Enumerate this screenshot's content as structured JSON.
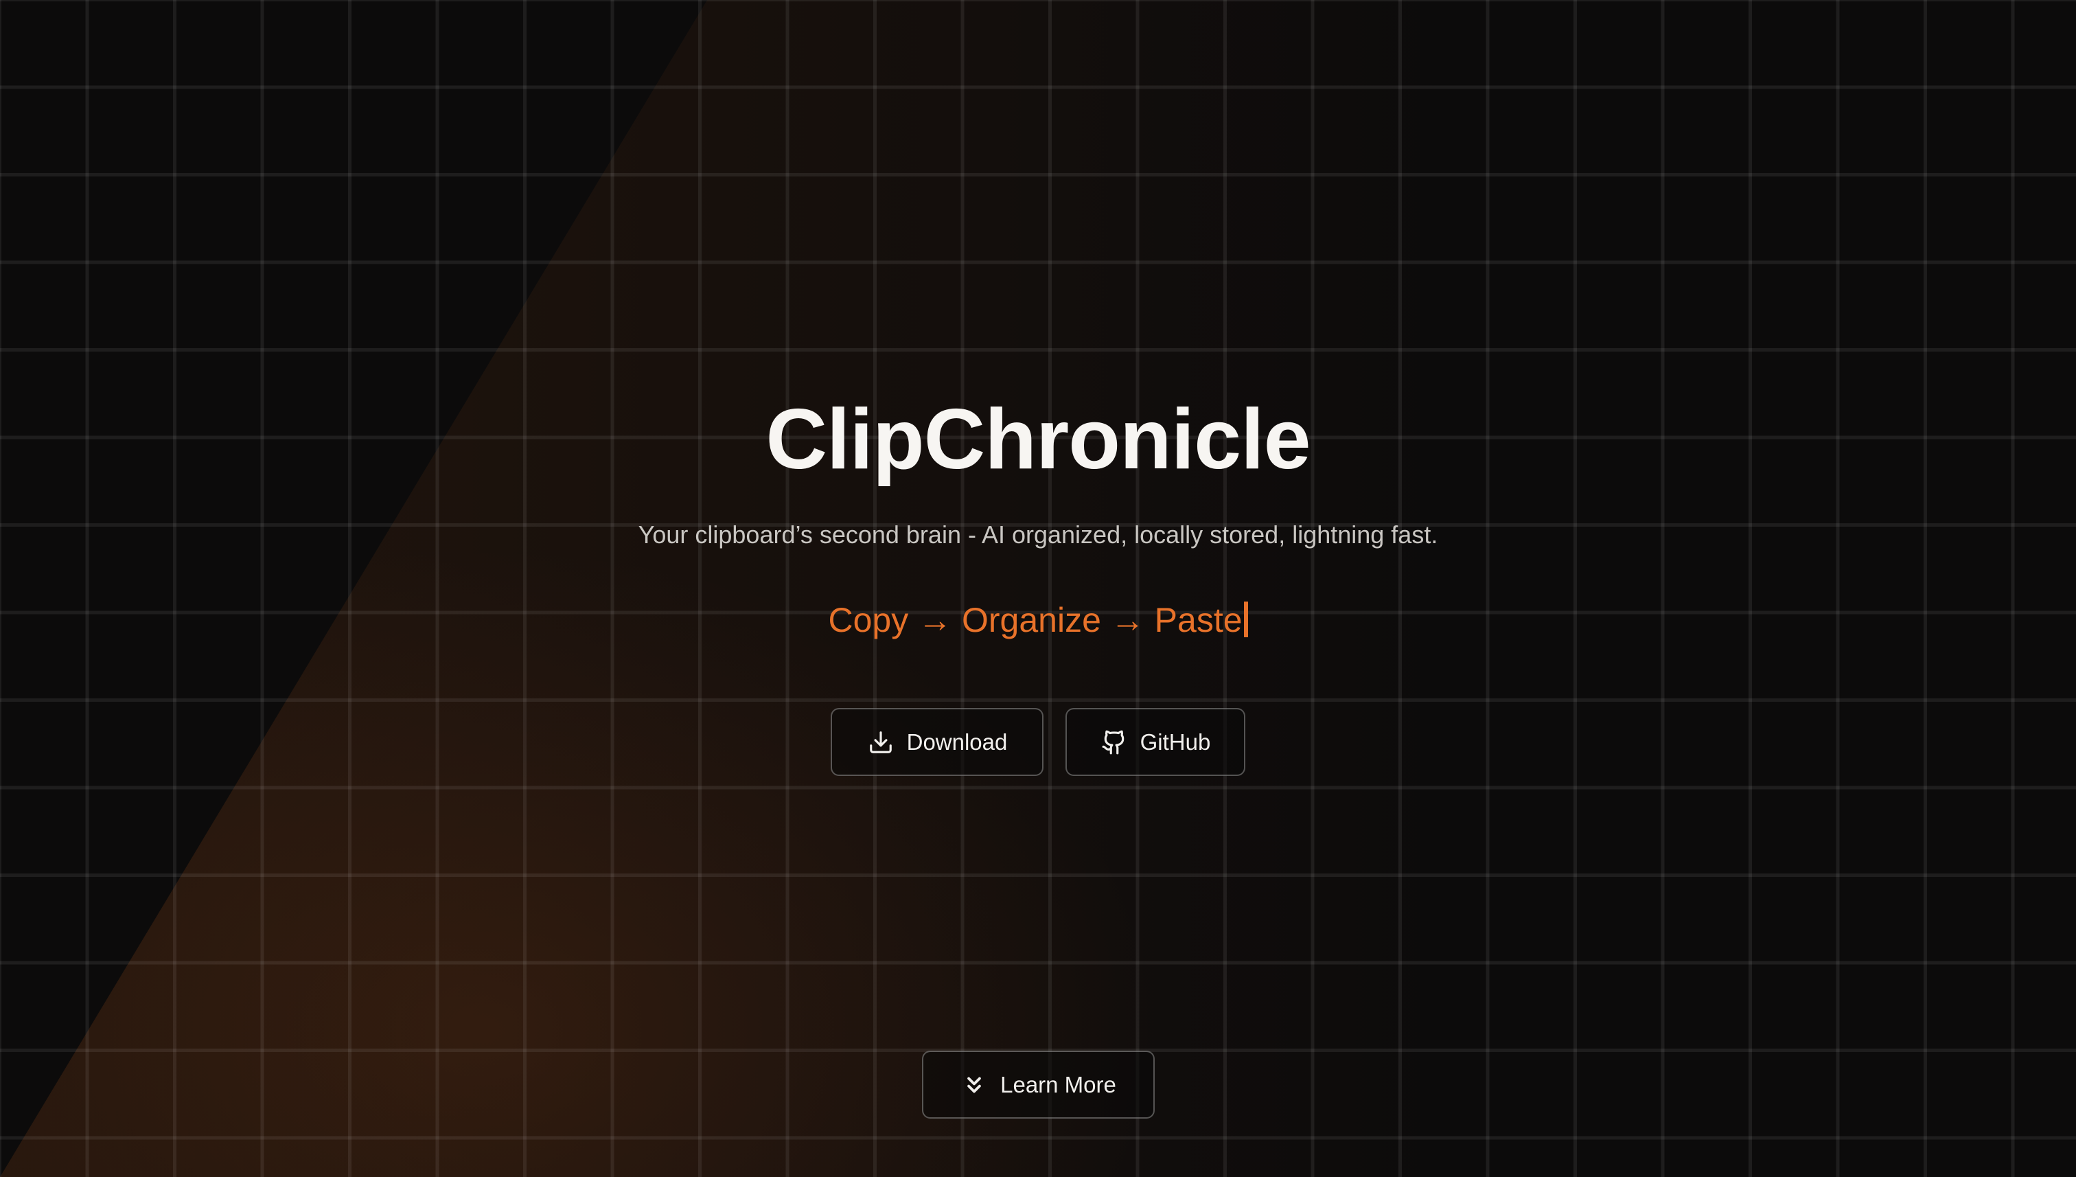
{
  "hero": {
    "title": "ClipChronicle",
    "subtitle": "Your clipboard’s second brain - AI organized, locally stored, lightning fast.",
    "tagline": "Copy → Organize → Paste"
  },
  "buttons": {
    "download": {
      "label": "Download",
      "icon": "download-icon"
    },
    "github": {
      "label": "GitHub",
      "icon": "github-icon"
    },
    "learn_more": {
      "label": "Learn More",
      "icon": "chevrons-down-icon"
    }
  },
  "colors": {
    "background": "#0c0b0b",
    "accent": "#e8722a",
    "title": "#f7f5f2",
    "subtitle": "#c9c6c2"
  }
}
